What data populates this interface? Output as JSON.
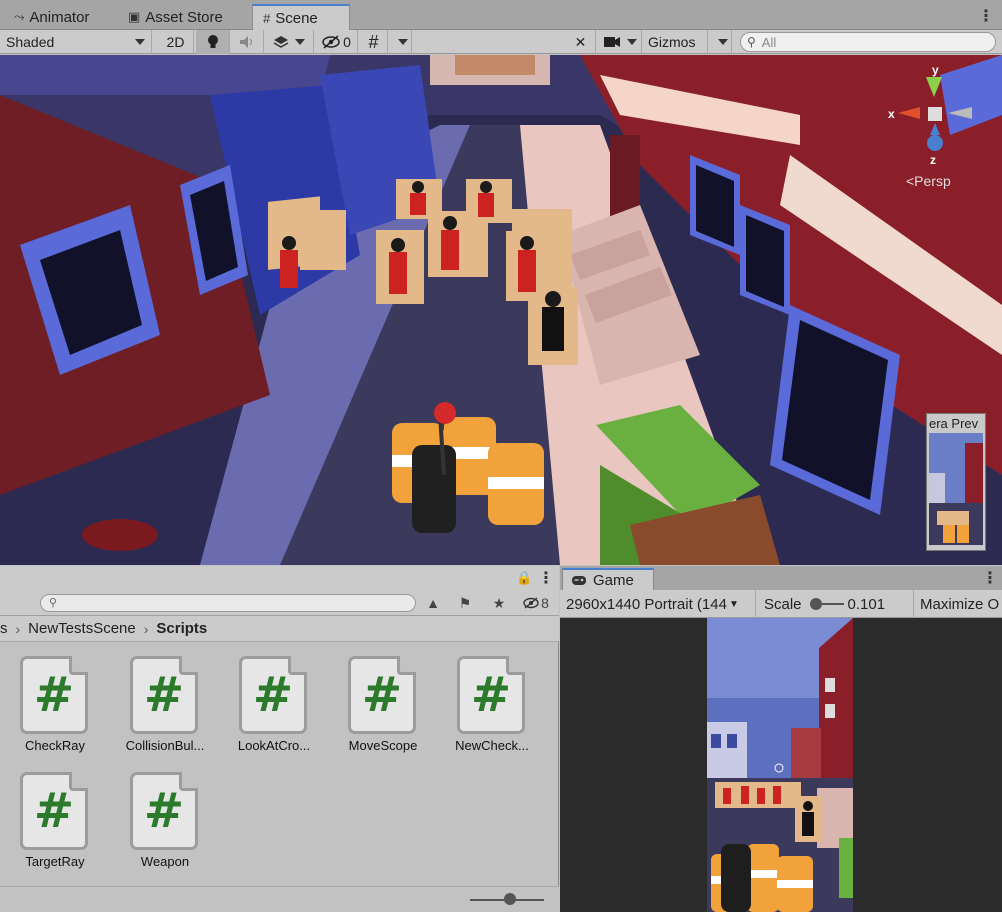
{
  "tabs": [
    {
      "label": "Animator",
      "icon": "animator-icon"
    },
    {
      "label": "Asset Store",
      "icon": "shopping-bag-icon"
    },
    {
      "label": "Scene",
      "icon": "grid-hash-icon"
    }
  ],
  "scene_toolbar": {
    "shading_mode": "Shaded",
    "mode_2d": "2D",
    "hidden_count": "0",
    "gizmos": "Gizmos",
    "search_placeholder": "All"
  },
  "scene_view": {
    "orientation_label": "<Persp",
    "axis_x": "x",
    "axis_y": "y",
    "axis_z": "z",
    "camera_preview_title": "era Prev"
  },
  "project": {
    "visible_count": "8",
    "breadcrumb": [
      "s",
      "NewTestsScene",
      "Scripts"
    ],
    "assets": [
      {
        "name": "CheckRay"
      },
      {
        "name": "CollisionBul..."
      },
      {
        "name": "LookAtCro..."
      },
      {
        "name": "MoveScope"
      },
      {
        "name": "NewCheck..."
      },
      {
        "name": "TargetRay"
      },
      {
        "name": "Weapon"
      }
    ],
    "asset_glyph": "#"
  },
  "game": {
    "tab_label": "Game",
    "resolution": "2960x1440 Portrait (144",
    "scale_label": "Scale",
    "scale_value": "0.101",
    "maximize": "Maximize O"
  },
  "colors": {
    "accent": "#4a7fd0",
    "script_hash": "#2c7a2c",
    "sky": "#5d6fbf",
    "brick": "#6e1e24",
    "barrel": "#f2a23a",
    "truck": "#6ab040"
  }
}
